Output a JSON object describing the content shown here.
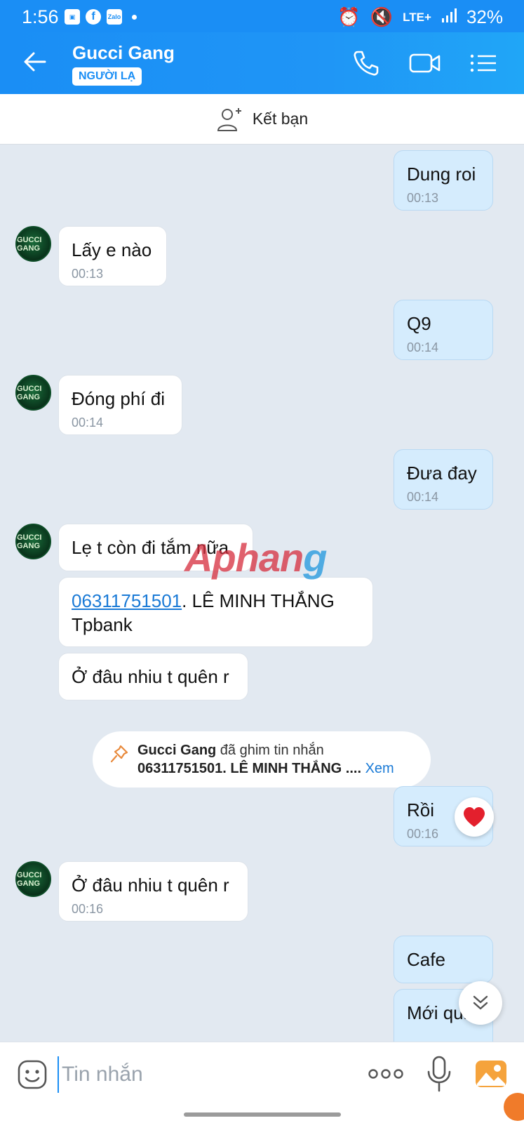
{
  "status_bar": {
    "time": "1:56",
    "zalo_label": "Zalo",
    "network": "LTE+",
    "battery": "32%"
  },
  "header": {
    "title": "Gucci Gang",
    "badge": "NGƯỜI LẠ"
  },
  "add_friend": {
    "label": "Kết bạn"
  },
  "messages": [
    {
      "dir": "out",
      "text": "Dung roi",
      "time": "00:13"
    },
    {
      "dir": "in",
      "text": "Lấy e nào",
      "time": "00:13"
    },
    {
      "dir": "out",
      "text": "Q9",
      "time": "00:14"
    },
    {
      "dir": "in",
      "text": "Đóng phí đi",
      "time": "00:14"
    },
    {
      "dir": "out",
      "text": "Đưa đay",
      "time": "00:14"
    },
    {
      "dir": "in",
      "text": "Lẹ t còn đi tắm nữa",
      "time": ""
    },
    {
      "dir": "in",
      "link": "06311751501",
      "text": ". LÊ MINH THẮNG",
      "text2": "Tpbank",
      "time": ""
    },
    {
      "dir": "in",
      "text": "Ở đâu nhiu t quên r",
      "time": ""
    },
    {
      "dir": "out",
      "text": "Rồi",
      "time": "00:16"
    },
    {
      "dir": "in",
      "text": "Ở đâu nhiu t quên r",
      "time": "00:16"
    },
    {
      "dir": "out",
      "text": "Cafe",
      "time": ""
    },
    {
      "dir": "out",
      "text": "Mới quit",
      "time": ""
    }
  ],
  "pinned": {
    "sender": "Gucci Gang",
    "action": " đã ghim tin nhắn",
    "content": "06311751501. LÊ MINH THẮNG ....",
    "view": "Xem"
  },
  "avatar_text": "GUCCI GANG",
  "watermark": {
    "a": "Aphan",
    "b": "g"
  },
  "input": {
    "placeholder": "Tin nhắn"
  },
  "colors": {
    "header": "#1a8ef5",
    "bubble_out": "#d5ecfd",
    "bubble_in": "#ffffff",
    "chat_bg": "#e2e9f1",
    "link": "#1a7ad6"
  },
  "icons": [
    "back-arrow-icon",
    "phone-icon",
    "video-call-icon",
    "menu-list-icon",
    "add-friend-icon",
    "pin-icon",
    "heart-icon",
    "scroll-down-icon",
    "emoji-icon",
    "more-icon",
    "microphone-icon",
    "gallery-icon"
  ]
}
